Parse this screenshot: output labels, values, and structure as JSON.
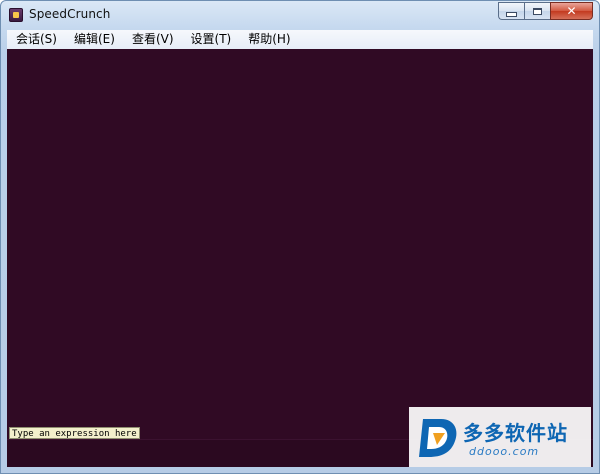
{
  "window": {
    "title": "SpeedCrunch"
  },
  "caption": {
    "minimize": "minimize",
    "maximize": "maximize",
    "close_glyph": "✕"
  },
  "menu": {
    "items": [
      {
        "label": "会话(S)"
      },
      {
        "label": "编辑(E)"
      },
      {
        "label": "查看(V)"
      },
      {
        "label": "设置(T)"
      },
      {
        "label": "帮助(H)"
      }
    ]
  },
  "editor": {
    "hint": "Type an expression here",
    "background": "#300a24"
  },
  "watermark": {
    "title": "多多软件站",
    "url": "ddooo.com",
    "color": "#0e66b3"
  }
}
